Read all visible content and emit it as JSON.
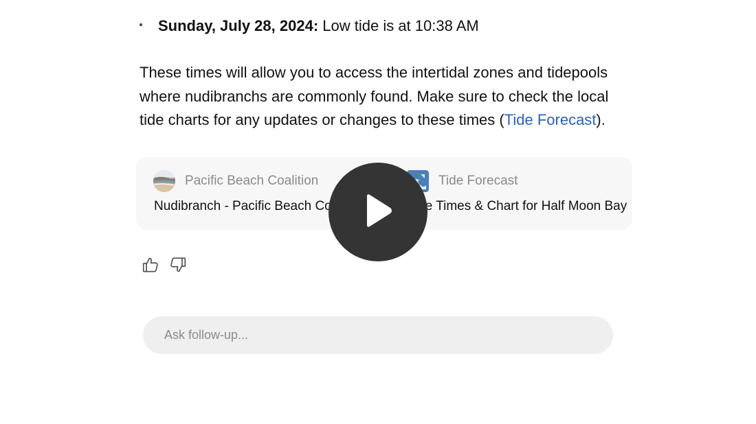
{
  "bullet": {
    "date": "Sunday, July 28, 2024:",
    "text": " Low tide is at 10:38 AM"
  },
  "paragraph": {
    "before_link": "These times will allow you to access the intertidal zones and tidepools where nudibranchs are commonly found. Make sure to check the local tide charts for any updates or changes to these times (",
    "link_text": "Tide Forecast",
    "after_link": ")."
  },
  "sources": [
    {
      "name": "Pacific Beach Coalition",
      "title": "Nudibranch - Pacific Beach Coalition",
      "icon": "beach-photo-icon"
    },
    {
      "name": "Tide Forecast",
      "title": "Tide Times & Chart for Half Moon Bay",
      "icon": "tide-forecast-logo-icon"
    }
  ],
  "feedback": {
    "up_icon": "thumbs-up-icon",
    "down_icon": "thumbs-down-icon"
  },
  "followup": {
    "placeholder": "Ask follow-up..."
  },
  "colors": {
    "link": "#2d62b3",
    "card_bg": "#f7f7f7",
    "input_bg": "#efefef",
    "overlay": "#343434"
  }
}
